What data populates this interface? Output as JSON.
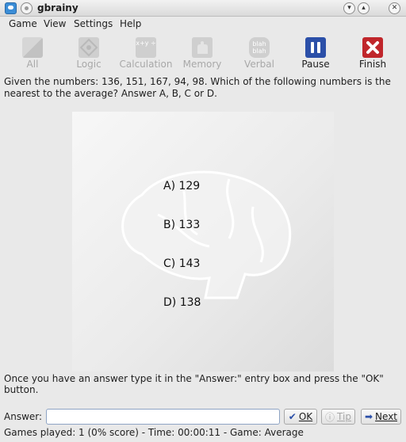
{
  "window": {
    "title": "gbrainy"
  },
  "menu": [
    "Game",
    "View",
    "Settings",
    "Help"
  ],
  "toolbar": [
    {
      "label": "All",
      "icon": "all-games-icon",
      "enabled": false
    },
    {
      "label": "Logic",
      "icon": "logic-icon",
      "enabled": false
    },
    {
      "label": "Calculation",
      "icon": "calculation-icon",
      "enabled": false
    },
    {
      "label": "Memory",
      "icon": "memory-icon",
      "enabled": false
    },
    {
      "label": "Verbal",
      "icon": "verbal-icon",
      "enabled": false
    },
    {
      "label": "Pause",
      "icon": "pause-icon",
      "enabled": true
    },
    {
      "label": "Finish",
      "icon": "finish-icon",
      "enabled": true
    }
  ],
  "icon_text": {
    "calculation": "x+y ÷",
    "verbal": "blah blah"
  },
  "question": "Given the numbers: 136, 151, 167, 94, 98. Which of the following numbers is the nearest to the average? Answer A, B, C or D.",
  "options": [
    "A) 129",
    "B) 133",
    "C) 143",
    "D) 138"
  ],
  "instruction": "Once you have an answer type it in the \"Answer:\" entry box and press the \"OK\" button.",
  "answer": {
    "label": "Answer:",
    "value": ""
  },
  "buttons": {
    "ok": "OK",
    "tip": "Tip",
    "next": "Next"
  },
  "status": "Games played: 1 (0% score) - Time: 00:00:11 - Game: Average",
  "colors": {
    "pause": "#2b4fa8",
    "finish": "#c0262b",
    "input_border": "#8ea4c4"
  }
}
